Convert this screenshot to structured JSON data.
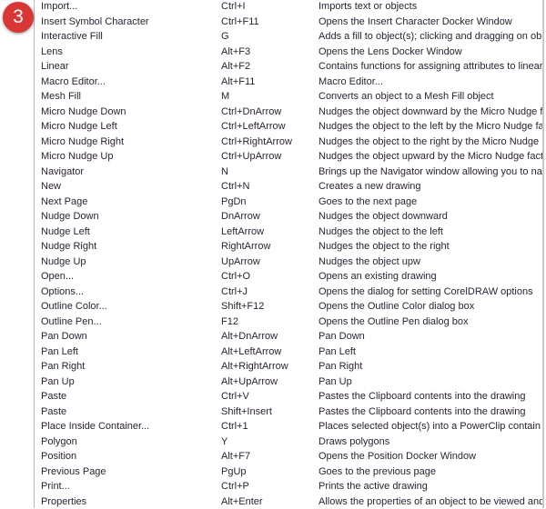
{
  "badge": "3",
  "colors": {
    "badge": "#d93636",
    "text": "#2c2233"
  },
  "commands": [
    [
      "Import...",
      "Ctrl+I",
      "Imports text or objects"
    ],
    [
      "Insert Symbol Character",
      "Ctrl+F11",
      "Opens the Insert Character Docker Window"
    ],
    [
      "Interactive Fill",
      "G",
      "Adds a fill to object(s); clicking and dragging on ob"
    ],
    [
      "Lens",
      "Alt+F3",
      "Opens the Lens Docker Window"
    ],
    [
      "Linear",
      "Alt+F2",
      "Contains functions for assigning attributes to linear"
    ],
    [
      "Macro Editor...",
      "Alt+F11",
      "Macro Editor..."
    ],
    [
      "Mesh Fill",
      "M",
      "Converts an object to a Mesh Fill object"
    ],
    [
      "Micro Nudge Down",
      "Ctrl+DnArrow",
      "Nudges the object downward by the Micro Nudge f"
    ],
    [
      "Micro Nudge Left",
      "Ctrl+LeftArrow",
      "Nudges the object to the left by the Micro Nudge fa"
    ],
    [
      "Micro Nudge Right",
      "Ctrl+RightArrow",
      "Nudges the object to the right by the Micro Nudge"
    ],
    [
      "Micro Nudge Up",
      "Ctrl+UpArrow",
      "Nudges the object upward by the Micro Nudge fact"
    ],
    [
      "Navigator",
      "N",
      "Brings up the Navigator window allowing you to nav"
    ],
    [
      "New",
      "Ctrl+N",
      "Creates a new drawing"
    ],
    [
      "Next Page",
      "PgDn",
      "Goes to the next page"
    ],
    [
      "Nudge Down",
      "DnArrow",
      "Nudges the object downward"
    ],
    [
      "Nudge Left",
      "LeftArrow",
      "Nudges the object to the left"
    ],
    [
      "Nudge Right",
      "RightArrow",
      "Nudges the object to the right"
    ],
    [
      "Nudge Up",
      "UpArrow",
      "Nudges the object upw"
    ],
    [
      "Open...",
      "Ctrl+O",
      "Opens an existing drawing"
    ],
    [
      "Options...",
      "Ctrl+J",
      "Opens the dialog for setting CorelDRAW options"
    ],
    [
      "Outline Color...",
      "Shift+F12",
      "Opens the Outline Color dialog box"
    ],
    [
      "Outline Pen...",
      "F12",
      "Opens the Outline Pen dialog box"
    ],
    [
      "Pan Down",
      "Alt+DnArrow",
      "Pan Down"
    ],
    [
      "Pan Left",
      "Alt+LeftArrow",
      "Pan Left"
    ],
    [
      "Pan Right",
      "Alt+RightArrow",
      "Pan Right"
    ],
    [
      "Pan Up",
      "Alt+UpArrow",
      "Pan Up"
    ],
    [
      "Paste",
      "Ctrl+V",
      "Pastes the Clipboard contents into the drawing"
    ],
    [
      "Paste",
      "Shift+Insert",
      "Pastes the Clipboard contents into the drawing"
    ],
    [
      "Place Inside Container...",
      "Ctrl+1",
      "Places selected object(s) into a PowerClip contain"
    ],
    [
      "Polygon",
      "Y",
      "Draws polygons"
    ],
    [
      "Position",
      "Alt+F7",
      "Opens the Position Docker Window"
    ],
    [
      "Previous Page",
      "PgUp",
      "Goes to the previous page"
    ],
    [
      "Print...",
      "Ctrl+P",
      "Prints the active drawing"
    ],
    [
      "Properties",
      "Alt+Enter",
      "Allows the properties of an object to be viewed and"
    ]
  ]
}
